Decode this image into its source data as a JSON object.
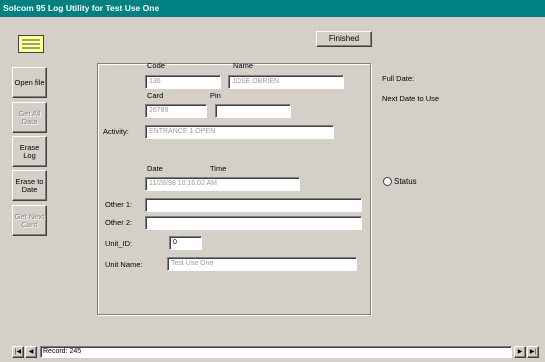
{
  "window": {
    "title": "Solcom 95 Log Utility for Test Use One"
  },
  "toolbar": {
    "finished_label": "Finished"
  },
  "sidebar": {
    "buttons": [
      {
        "label": "Open file",
        "enabled": true
      },
      {
        "label": "Get All Data",
        "enabled": false
      },
      {
        "label": "Erase Log",
        "enabled": true
      },
      {
        "label": "Erase to Date",
        "enabled": true
      },
      {
        "label": "Get Next Card",
        "enabled": false
      }
    ]
  },
  "form": {
    "code_label": "Code",
    "code_value": "136",
    "name_label": "Name",
    "name_value": "JOSE OBRIEN",
    "card_label": "Card",
    "card_value": "26789",
    "pin_label": "Pin",
    "pin_value": "",
    "activity_label": "Activity:",
    "activity_value": "ENTRANCE 1 OPEN",
    "date_label": "Date",
    "time_label": "Time",
    "datetime_value": "11/28/98 10:16:02 AM",
    "other1_label": "Other 1:",
    "other1_value": "",
    "other2_label": "Other 2:",
    "other2_value": "",
    "unit_id_label": "Unit_ID:",
    "unit_id_value": "0",
    "unit_name_label": "Unit Name:",
    "unit_name_value": "Test Use One"
  },
  "right": {
    "full_date_label": "Full Date:",
    "next_date_label": "Next Date to Use",
    "status_label": "Status"
  },
  "record_bar": {
    "first_glyph": "|◀",
    "prev_glyph": "◀",
    "next_glyph": "▶",
    "last_glyph": "▶|",
    "record_label": "Record: 245"
  }
}
